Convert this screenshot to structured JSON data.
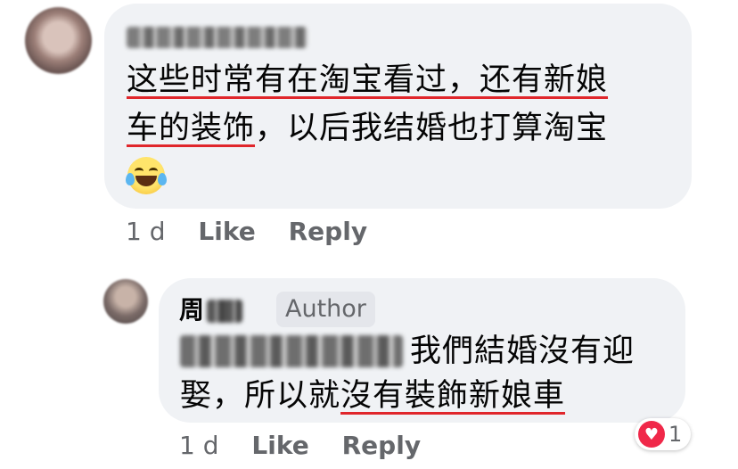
{
  "comment": {
    "line1_pre": "这些时常有在淘宝看过，还有新娘",
    "line2_underlined": "车的装饰",
    "line2_rest": "，以后我结婚也打算淘宝",
    "emoji": "😂",
    "time": "1 d",
    "like": "Like",
    "reply": "Reply"
  },
  "reply": {
    "author_surname": "周",
    "author_badge": "Author",
    "line1_text": "我們結婚沒有迎",
    "line2_pre": "娶，所以就",
    "line2_underlined": "沒有裝飾新娘車",
    "time": "1 d",
    "like": "Like",
    "reply": "Reply",
    "reaction_icon": "heart-icon",
    "reaction_count": "1"
  },
  "colors": {
    "bubble": "#f0f2f5",
    "underline": "#e0262b",
    "meta": "#65676b",
    "heart": "#f02849"
  }
}
